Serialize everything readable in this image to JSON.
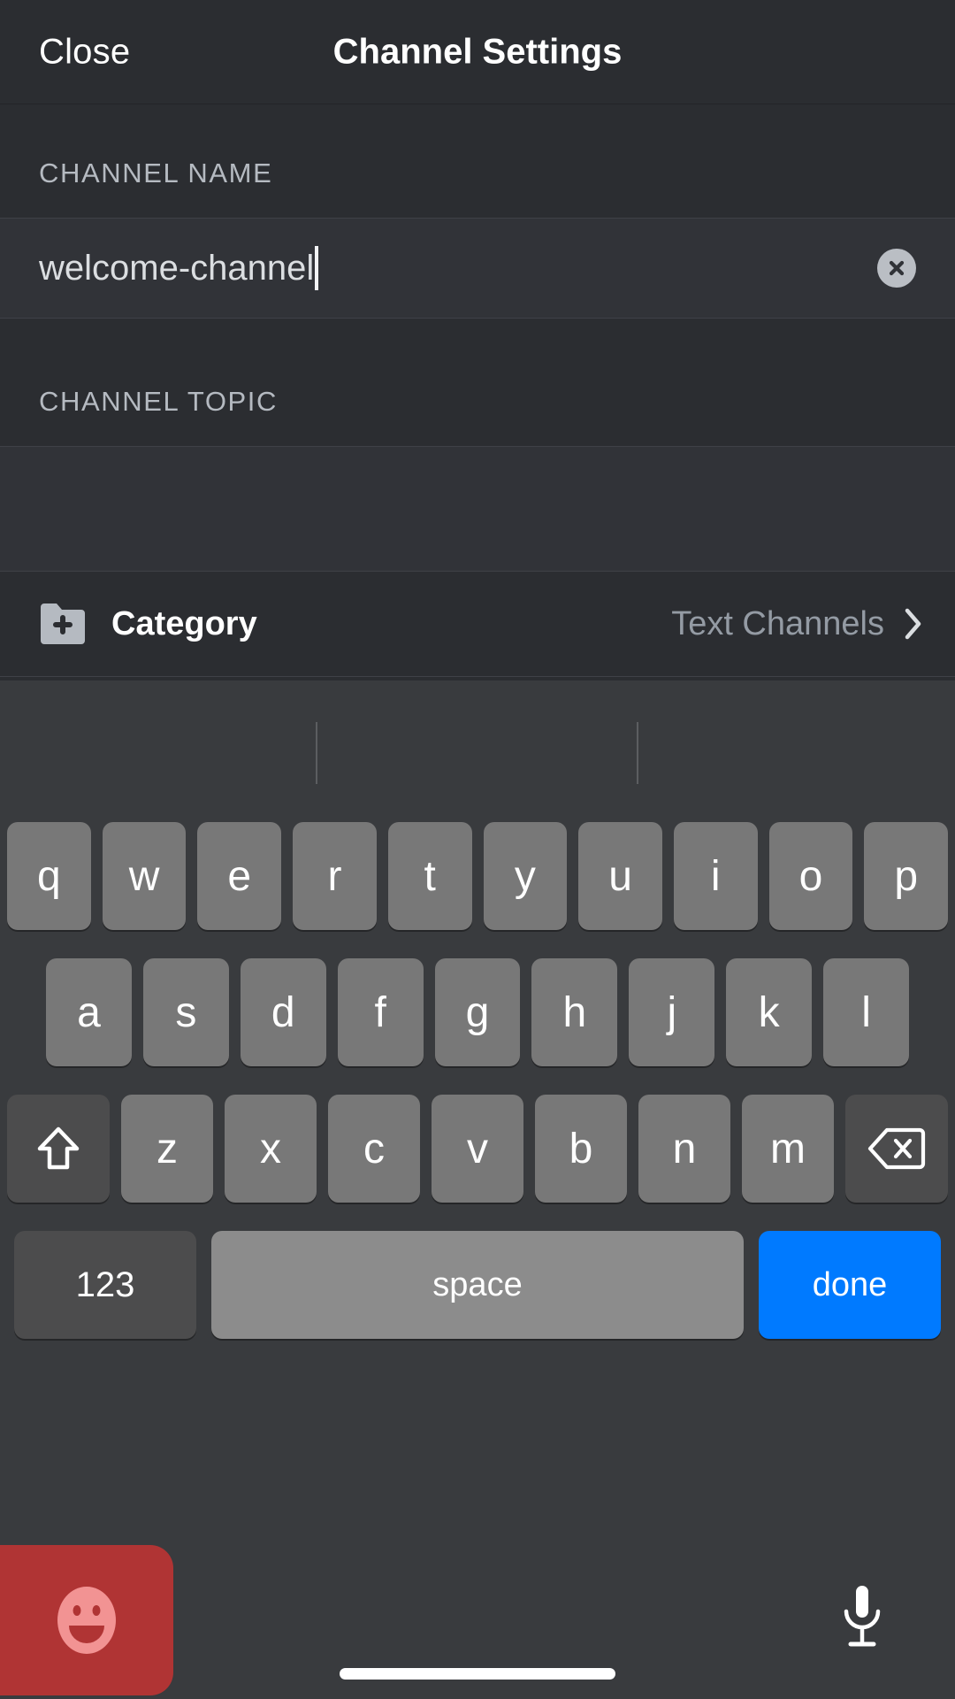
{
  "header": {
    "close_label": "Close",
    "title": "Channel Settings"
  },
  "form": {
    "channel_name": {
      "section_label": "CHANNEL NAME",
      "value": "welcome-channel",
      "placeholder": "",
      "clear_icon": "clear-circle-icon",
      "has_caret": true
    },
    "channel_topic": {
      "section_label": "CHANNEL TOPIC",
      "value": "",
      "placeholder": ""
    },
    "category": {
      "icon": "folder-plus-icon",
      "label": "Category",
      "value": "Text Channels",
      "chevron_icon": "chevron-right-icon"
    }
  },
  "keyboard": {
    "row1": [
      "q",
      "w",
      "e",
      "r",
      "t",
      "y",
      "u",
      "i",
      "o",
      "p"
    ],
    "row2": [
      "a",
      "s",
      "d",
      "f",
      "g",
      "h",
      "j",
      "k",
      "l"
    ],
    "row3": [
      "z",
      "x",
      "c",
      "v",
      "b",
      "n",
      "m"
    ],
    "shift_icon": "shift-arrow-icon",
    "backspace_icon": "backspace-delete-icon",
    "numbers_label": "123",
    "space_label": "space",
    "done_label": "done"
  },
  "bottom_bar": {
    "emoji_icon": "smiley-face-icon",
    "mic_icon": "microphone-icon",
    "home_indicator": "home-indicator"
  },
  "colors": {
    "app_background": "#2b2d31",
    "input_background": "#313338",
    "keyboard_background": "#393b3e",
    "key_grey": "#787878",
    "key_dark": "#4c4c4d",
    "key_space": "#8c8c8c",
    "done_blue": "#007aff",
    "emoji_red": "#b03434",
    "text_primary": "#ffffff",
    "text_secondary": "#949ba4",
    "label_grey": "#b5bac1"
  }
}
